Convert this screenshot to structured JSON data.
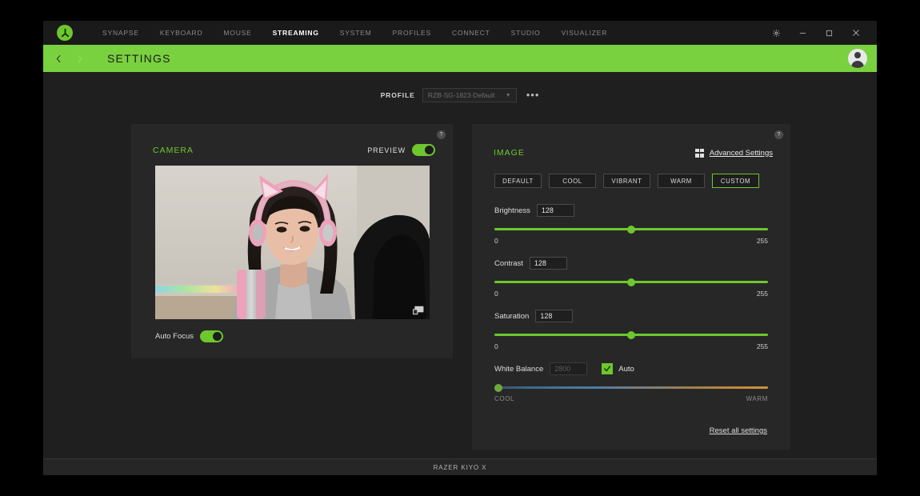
{
  "window": {
    "logo_icon": "razer-logo-icon",
    "nav_items": [
      {
        "label": "SYNAPSE",
        "active": false
      },
      {
        "label": "KEYBOARD",
        "active": false
      },
      {
        "label": "MOUSE",
        "active": false
      },
      {
        "label": "STREAMING",
        "active": true
      },
      {
        "label": "SYSTEM",
        "active": false
      },
      {
        "label": "PROFILES",
        "active": false
      },
      {
        "label": "CONNECT",
        "active": false
      },
      {
        "label": "STUDIO",
        "active": false
      },
      {
        "label": "VISUALIZER",
        "active": false
      }
    ],
    "controls": [
      {
        "name": "gear-icon"
      },
      {
        "name": "minimize-icon"
      },
      {
        "name": "maximize-icon"
      },
      {
        "name": "close-icon"
      }
    ]
  },
  "header": {
    "title": "SETTINGS",
    "back_icon": "chevron-left-icon",
    "forward_icon": "chevron-right-icon",
    "avatar_icon": "user-avatar-icon",
    "accent_color": "#7ad13f"
  },
  "profile": {
    "label": "PROFILE",
    "value": "RZB-SG-1823-Default",
    "caret_icon": "chevron-down-icon",
    "more_label": "•••"
  },
  "camera": {
    "title": "CAMERA",
    "preview_label": "PREVIEW",
    "preview_enabled": true,
    "help_icon": "?",
    "pip_icon": "picture-in-picture-icon",
    "auto_focus_label": "Auto Focus",
    "auto_focus_enabled": true
  },
  "image": {
    "title": "IMAGE",
    "help_icon": "?",
    "advanced_settings_label": "Advanced Settings",
    "windows_icon": "windows-logo-icon",
    "presets": [
      {
        "label": "DEFAULT",
        "active": false
      },
      {
        "label": "COOL",
        "active": false
      },
      {
        "label": "VIBRANT",
        "active": false
      },
      {
        "label": "WARM",
        "active": false
      },
      {
        "label": "CUSTOM",
        "active": true
      }
    ],
    "sliders": [
      {
        "label": "Brightness",
        "value": "128",
        "min": "0",
        "max": "255",
        "percent": 50,
        "disabled": false
      },
      {
        "label": "Contrast",
        "value": "128",
        "min": "0",
        "max": "255",
        "percent": 50,
        "disabled": false
      },
      {
        "label": "Saturation",
        "value": "128",
        "min": "0",
        "max": "255",
        "percent": 50,
        "disabled": false
      }
    ],
    "white_balance": {
      "label": "White Balance",
      "value": "2800",
      "disabled": true,
      "auto_label": "Auto",
      "auto_checked": true,
      "min": "COOL",
      "max": "WARM",
      "percent": 1
    },
    "reset_label": "Reset all settings",
    "accent_color": "#6ec72d"
  },
  "footer": {
    "device": "RAZER KIYO X"
  }
}
